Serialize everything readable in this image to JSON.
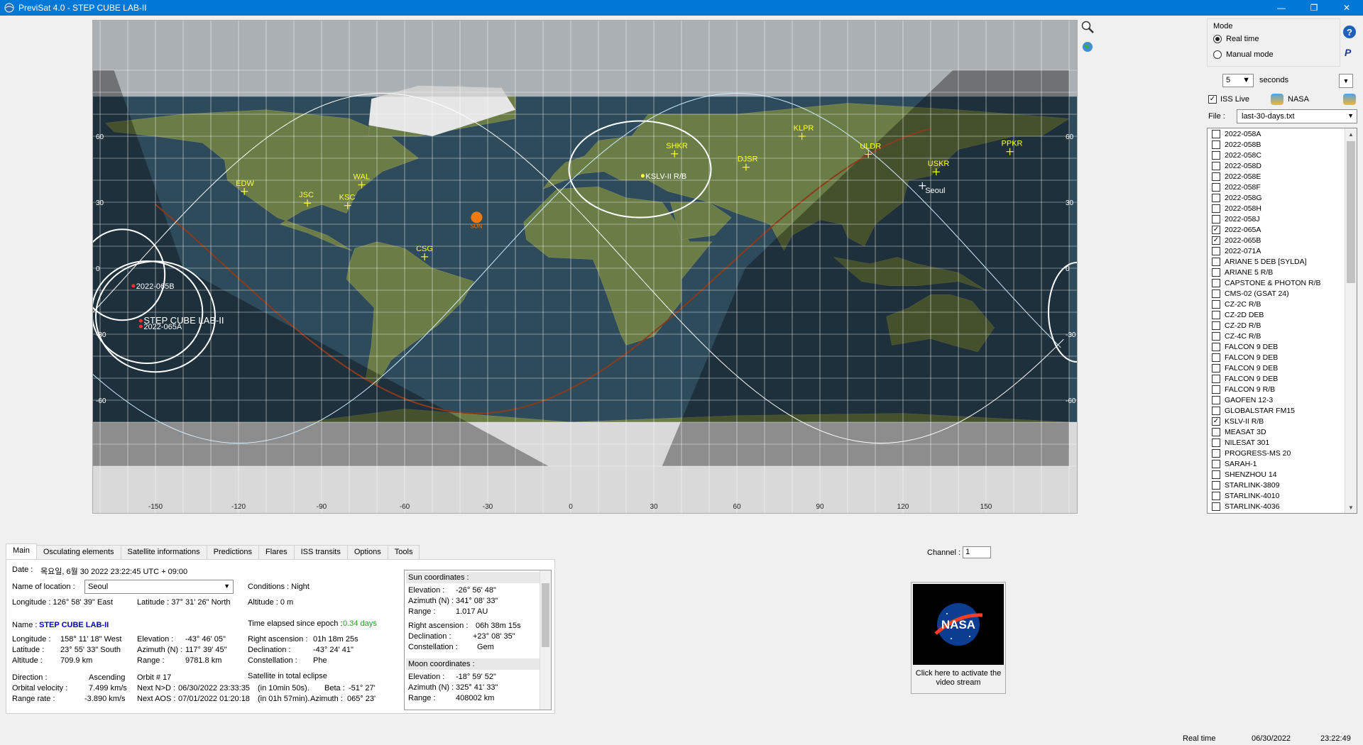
{
  "window": {
    "title": "PreviSat 4.0 - STEP CUBE LAB-II",
    "buttons": [
      "—",
      "❐",
      "✕"
    ]
  },
  "map": {
    "lon_ticks": [
      "-150",
      "-120",
      "-90",
      "-60",
      "-30",
      "0",
      "30",
      "60",
      "90",
      "120",
      "150"
    ],
    "lat_ticks": [
      "60",
      "30",
      "0",
      "-30",
      "-60"
    ],
    "stations": [
      {
        "code": "EDW",
        "lon": -117.9,
        "lat": 34.9
      },
      {
        "code": "JSC",
        "lon": -95.1,
        "lat": 29.6
      },
      {
        "code": "KSC",
        "lon": -80.6,
        "lat": 28.5
      },
      {
        "code": "WAL",
        "lon": -75.5,
        "lat": 37.9
      },
      {
        "code": "CSG",
        "lon": -52.8,
        "lat": 5.2
      },
      {
        "code": "SHKR",
        "lon": 37.5,
        "lat": 52.0
      },
      {
        "code": "DJSR",
        "lon": 63.3,
        "lat": 45.9
      },
      {
        "code": "KLPR",
        "lon": 83.5,
        "lat": 60.0
      },
      {
        "code": "ULDR",
        "lon": 107.5,
        "lat": 51.8
      },
      {
        "code": "USKR",
        "lon": 132.0,
        "lat": 43.8
      },
      {
        "code": "PPKR",
        "lon": 158.6,
        "lat": 53.0
      }
    ],
    "sun": {
      "label": "SUN",
      "lon": -34,
      "lat": 23.1
    },
    "location": {
      "label": "Seoul",
      "lon": 127.0,
      "lat": 37.5
    },
    "satellites": [
      {
        "label": "2022-065B",
        "lon": -158,
        "lat": -8
      },
      {
        "label": "STEP CUBE LAB-II",
        "lon": -155.3,
        "lat": -23.9
      },
      {
        "label": "2022-065A",
        "lon": -155.3,
        "lat": -26.5
      },
      {
        "label": "KSLV-II R/B",
        "lon": 26,
        "lat": 42
      }
    ]
  },
  "right_panel": {
    "mode_label": "Mode",
    "mode_options": [
      "Real time",
      "Manual mode"
    ],
    "mode_selected": "Real time",
    "step_value": "5",
    "step_unit": "seconds",
    "iss_live_label": "ISS Live",
    "iss_live_checked": true,
    "nasa_label": "NASA",
    "file_label": "File :",
    "file_value": "last-30-days.txt",
    "satellites": [
      {
        "name": "2022-058A",
        "checked": false
      },
      {
        "name": "2022-058B",
        "checked": false
      },
      {
        "name": "2022-058C",
        "checked": false
      },
      {
        "name": "2022-058D",
        "checked": false
      },
      {
        "name": "2022-058E",
        "checked": false
      },
      {
        "name": "2022-058F",
        "checked": false
      },
      {
        "name": "2022-058G",
        "checked": false
      },
      {
        "name": "2022-058H",
        "checked": false
      },
      {
        "name": "2022-058J",
        "checked": false
      },
      {
        "name": "2022-065A",
        "checked": true
      },
      {
        "name": "2022-065B",
        "checked": true
      },
      {
        "name": "2022-071A",
        "checked": false
      },
      {
        "name": "ARIANE 5 DEB [SYLDA]",
        "checked": false
      },
      {
        "name": "ARIANE 5 R/B",
        "checked": false
      },
      {
        "name": "CAPSTONE & PHOTON R/B",
        "checked": false
      },
      {
        "name": "CMS-02 (GSAT 24)",
        "checked": false
      },
      {
        "name": "CZ-2C R/B",
        "checked": false
      },
      {
        "name": "CZ-2D DEB",
        "checked": false
      },
      {
        "name": "CZ-2D R/B",
        "checked": false
      },
      {
        "name": "CZ-4C R/B",
        "checked": false
      },
      {
        "name": "FALCON 9 DEB",
        "checked": false
      },
      {
        "name": "FALCON 9 DEB",
        "checked": false
      },
      {
        "name": "FALCON 9 DEB",
        "checked": false
      },
      {
        "name": "FALCON 9 DEB",
        "checked": false
      },
      {
        "name": "FALCON 9 R/B",
        "checked": false
      },
      {
        "name": "GAOFEN 12-3",
        "checked": false
      },
      {
        "name": "GLOBALSTAR FM15",
        "checked": false
      },
      {
        "name": "KSLV-II R/B",
        "checked": true
      },
      {
        "name": "MEASAT 3D",
        "checked": false
      },
      {
        "name": "NILESAT 301",
        "checked": false
      },
      {
        "name": "PROGRESS-MS 20",
        "checked": false
      },
      {
        "name": "SARAH-1",
        "checked": false
      },
      {
        "name": "SHENZHOU 14",
        "checked": false
      },
      {
        "name": "STARLINK-3809",
        "checked": false
      },
      {
        "name": "STARLINK-4010",
        "checked": false
      },
      {
        "name": "STARLINK-4036",
        "checked": false
      }
    ]
  },
  "tabs": [
    "Main",
    "Osculating elements",
    "Satellite informations",
    "Predictions",
    "Flares",
    "ISS transits",
    "Options",
    "Tools"
  ],
  "main": {
    "date_label": "Date :",
    "date_value": "목요일, 6월 30 2022  23:22:45  UTC + 09:00",
    "location_label": "Name of location :",
    "location_value": "Seoul",
    "conditions": "Conditions :  Night",
    "longitude": "Longitude :  126° 58' 39\" East",
    "latitude": "Latitude :  37° 31' 26\" North",
    "altitude": "Altitude :  0 m",
    "name_label": "Name :",
    "name_value": "STEP CUBE LAB-II",
    "time_elapsed_label": "Time elapsed since epoch :",
    "time_elapsed_value": "0.34 days",
    "sat_longitude_label": "Longitude :",
    "sat_longitude_value": "158° 11' 18\" West",
    "sat_latitude_label": "Latitude :",
    "sat_latitude_value": "23° 55' 33\" South",
    "sat_altitude_label": "Altitude :",
    "sat_altitude_value": "709.9 km",
    "elevation_label": "Elevation :",
    "elevation_value": "-43° 46' 05\"",
    "azimuth_label": "Azimuth (N) :",
    "azimuth_value": "117° 39' 45\"",
    "range_label": "Range :",
    "range_value": "9781.8 km",
    "ra_label": "Right ascension :",
    "ra_value": "01h 18m 25s",
    "decl_label": "Declination :",
    "decl_value": "-43° 24' 41\"",
    "const_label": "Constellation :",
    "const_value": "Phe",
    "direction_label": "Direction :",
    "direction_value": "Ascending",
    "orbit_label": "Orbit # 17",
    "eclipse_text": "Satellite in total eclipse",
    "velocity_label": "Orbital velocity :",
    "velocity_value": "7.499 km/s",
    "next_nd_label": "Next N>D :",
    "next_nd_value": "06/30/2022 23:33:35",
    "next_nd_delta": "(in 10min 50s).",
    "beta_label": "Beta :",
    "beta_value": "-51° 27'",
    "range_rate_label": "Range rate :",
    "range_rate_value": "-3.890 km/s",
    "next_aos_label": "Next AOS :",
    "next_aos_value": "07/01/2022 01:20:18",
    "next_aos_delta": "(in 01h 57min).",
    "aos_azimuth_label": "Azimuth :",
    "aos_azimuth_value": "065° 23'"
  },
  "sun_coords": {
    "header": "Sun coordinates :",
    "elevation_label": "Elevation :",
    "elevation_value": "-26° 56' 48\"",
    "azimuth_label": "Azimuth (N) :",
    "azimuth_value": "341° 08' 33\"",
    "range_label": "Range :",
    "range_value": "1.017 AU",
    "ra_label": "Right ascension :",
    "ra_value": "06h 38m 15s",
    "decl_label": "Declination :",
    "decl_value": "+23° 08' 35\"",
    "const_label": "Constellation :",
    "const_value": "Gem"
  },
  "moon_coords": {
    "header": "Moon coordinates :",
    "elevation_label": "Elevation :",
    "elevation_value": "-18° 59' 52\"",
    "azimuth_label": "Azimuth (N) :",
    "azimuth_value": "325° 41' 33\"",
    "range_label": "Range :",
    "range_value": "408002 km"
  },
  "channel": {
    "label": "Channel :",
    "value": "1"
  },
  "video": {
    "caption": "Click here to activate the video stream",
    "logo_text": "NASA"
  },
  "status": {
    "mode": "Real time",
    "date": "06/30/2022",
    "time": "23:22:49"
  },
  "colors": {
    "title_bar": "#0078d7",
    "ocean": "#2e4b5c",
    "station": "#ffff33",
    "sun": "#f07a10",
    "terminator": "#8b3a1a",
    "sat_name": "#0000cc"
  }
}
